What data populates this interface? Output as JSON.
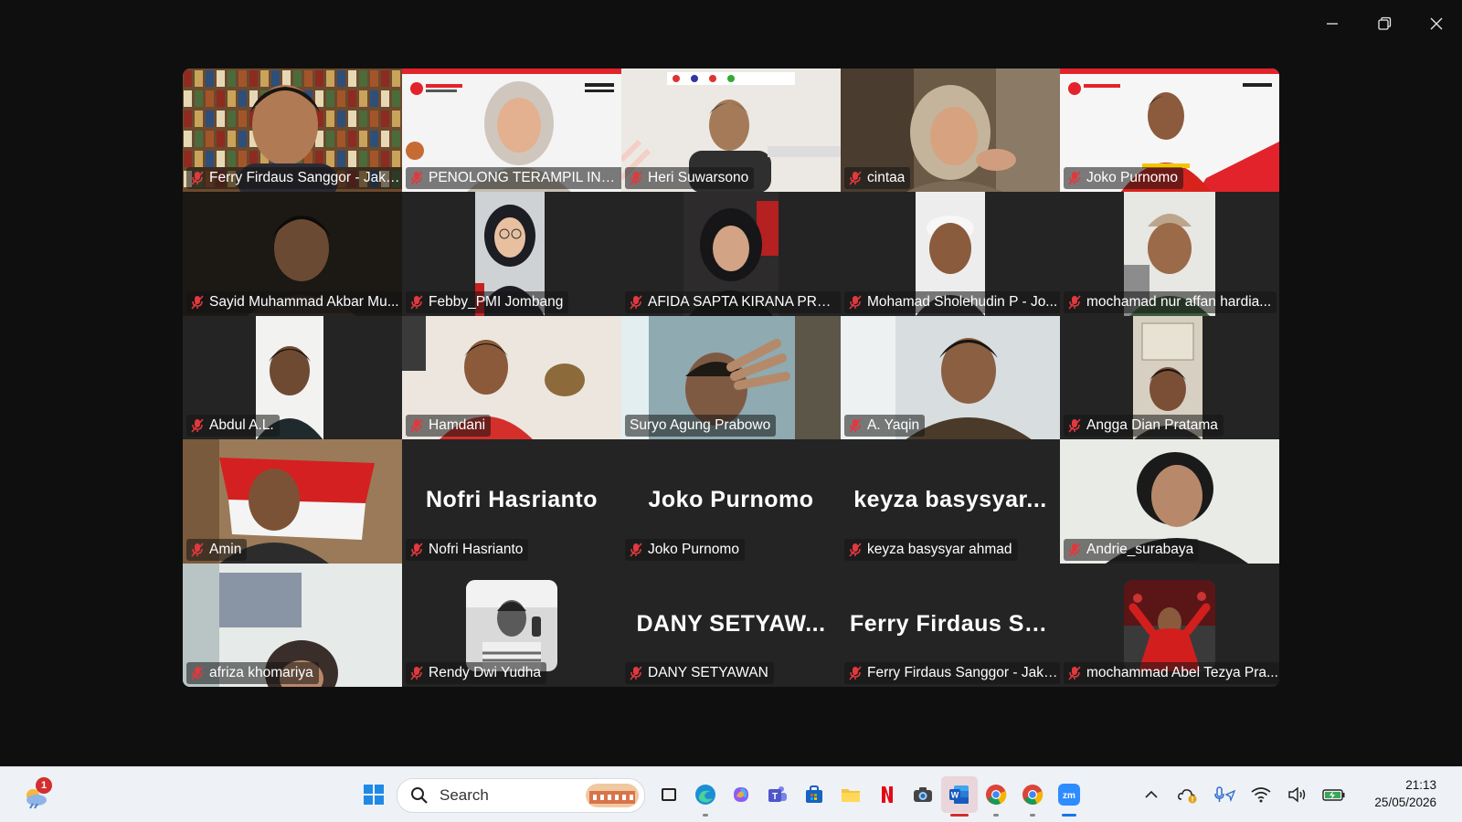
{
  "window": {
    "controls": [
      "minimize",
      "restore",
      "close"
    ]
  },
  "participants": [
    {
      "name": "Ferry Firdaus Sanggor - Jaka...",
      "video": true,
      "muted": true
    },
    {
      "name": "PENOLONG TERAMPIL INDONE...",
      "video": true,
      "muted": true,
      "active_speaker": true
    },
    {
      "name": "Heri Suwarsono",
      "video": true,
      "muted": true
    },
    {
      "name": "cintaa",
      "video": true,
      "muted": true
    },
    {
      "name": "Joko Purnomo",
      "video": true,
      "muted": true
    },
    {
      "name": "Sayid Muhammad Akbar Mu...",
      "video": true,
      "muted": true
    },
    {
      "name": "Febby_PMI Jombang",
      "video": true,
      "muted": true
    },
    {
      "name": "AFIDA SAPTA KIRANA PRODI...",
      "video": true,
      "muted": true
    },
    {
      "name": "Mohamad Sholehudin P - Jo...",
      "video": true,
      "muted": true
    },
    {
      "name": "mochamad nur affan hardia...",
      "video": true,
      "muted": true
    },
    {
      "name": "Abdul A.L.",
      "video": true,
      "muted": true
    },
    {
      "name": "Hamdani",
      "video": true,
      "muted": true
    },
    {
      "name": "Suryo Agung Prabowo",
      "video": true,
      "muted": false
    },
    {
      "name": "A. Yaqin",
      "video": true,
      "muted": true
    },
    {
      "name": "Angga Dian Pratama",
      "video": true,
      "muted": true
    },
    {
      "name": "Amin",
      "video": true,
      "muted": true
    },
    {
      "name": "Nofri Hasrianto",
      "video": false,
      "muted": true,
      "display_name": "Nofri Hasrianto"
    },
    {
      "name": "Joko Purnomo",
      "video": false,
      "muted": true,
      "display_name": "Joko Purnomo"
    },
    {
      "name": "keyza basysyar ahmad",
      "video": false,
      "muted": true,
      "display_name": "keyza  basysyar..."
    },
    {
      "name": "Andrie_surabaya",
      "video": true,
      "muted": true
    },
    {
      "name": "afriza khomariya",
      "video": true,
      "muted": true
    },
    {
      "name": "Rendy Dwi Yudha",
      "video": false,
      "muted": true,
      "avatar": true
    },
    {
      "name": "DANY SETYAWAN",
      "video": false,
      "muted": true,
      "display_name": "DANY  SETYAW..."
    },
    {
      "name": "Ferry Firdaus Sanggor - Jaka...",
      "video": false,
      "muted": true,
      "display_name": "Ferry  Firdaus  Sa..."
    },
    {
      "name": "mochammad Abel Tezya Pra...",
      "video": false,
      "muted": true,
      "avatar": true
    }
  ],
  "taskbar": {
    "notification_count": "1",
    "search_label": "Search",
    "apps": [
      "task-view",
      "edge",
      "copilot",
      "teams",
      "store",
      "file-explorer",
      "netflix",
      "camera",
      "word",
      "chrome",
      "chrome-profile",
      "zoom"
    ],
    "time": "21:13",
    "date": "25/05/2026"
  },
  "colors": {
    "background": "#0f0f10",
    "tile": "#242424",
    "active_speaker_border": "#2fe08a",
    "muted_icon": "#e0393e",
    "taskbar": "#eef1f5"
  }
}
